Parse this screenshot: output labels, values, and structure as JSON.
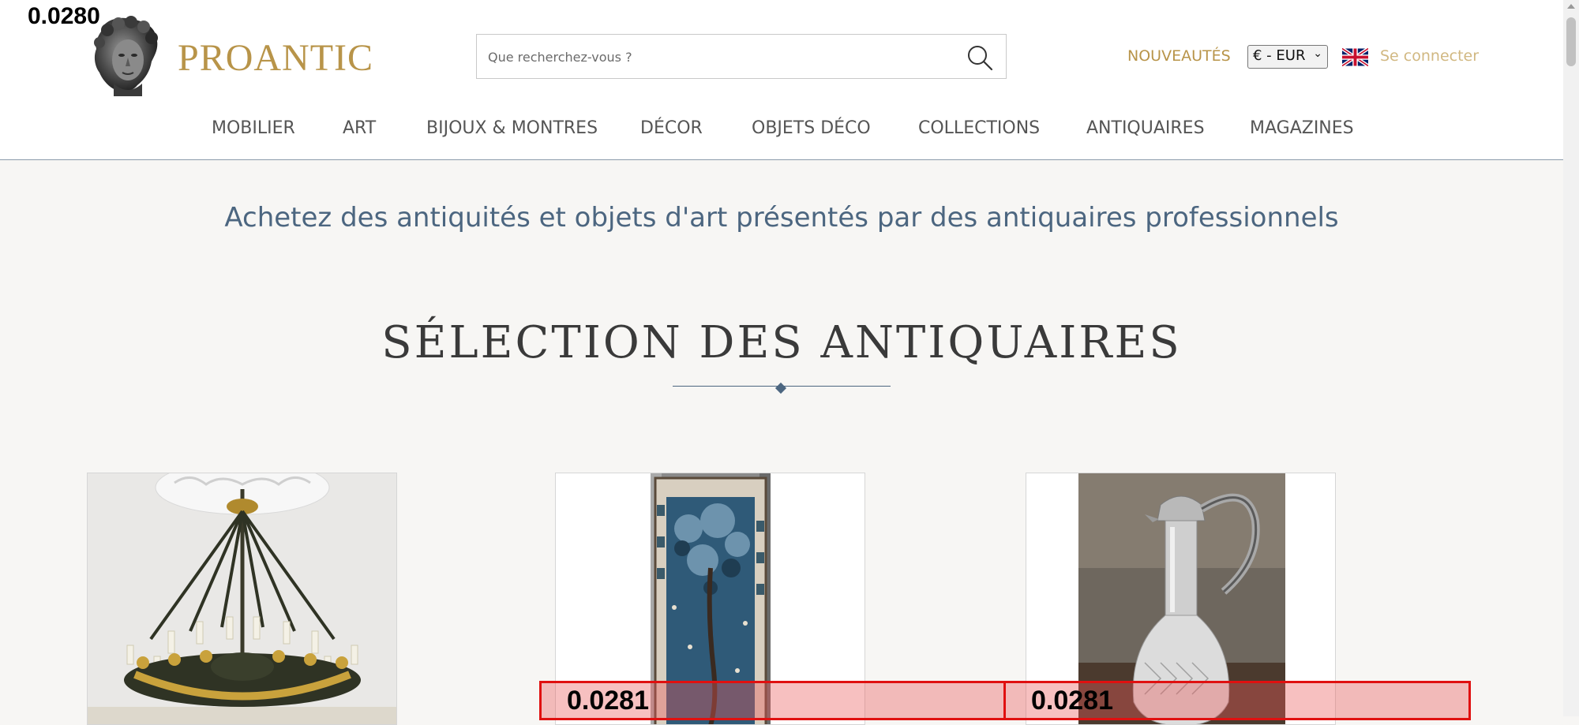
{
  "debug": {
    "top_label": "0.0280",
    "box_labels": [
      "0.0281",
      "0.0281"
    ]
  },
  "header": {
    "logo_text": "PROANTIC",
    "search": {
      "placeholder": "Que recherchez-vous ?",
      "icon": "search-icon"
    },
    "nouveautes": "NOUVEAUTÉS",
    "currency": "€ - EUR",
    "language_flag": "uk-flag-icon",
    "login": "Se connecter",
    "brand_color": "#b89449"
  },
  "nav": {
    "items": [
      "MOBILIER",
      "ART",
      "BIJOUX & MONTRES",
      "DÉCOR",
      "OBJETS DÉCO",
      "COLLECTIONS",
      "ANTIQUAIRES",
      "MAGAZINES"
    ]
  },
  "main": {
    "tagline": "Achetez des antiquités et objets d'art présentés par des antiquaires professionnels",
    "section_title": "SÉLECTION DES ANTIQUAIRES",
    "accent_color": "#4c6680",
    "products": [
      {
        "image": "chandelier-image"
      },
      {
        "image": "tapestry-image"
      },
      {
        "image": "silver-carafe-image"
      }
    ]
  }
}
